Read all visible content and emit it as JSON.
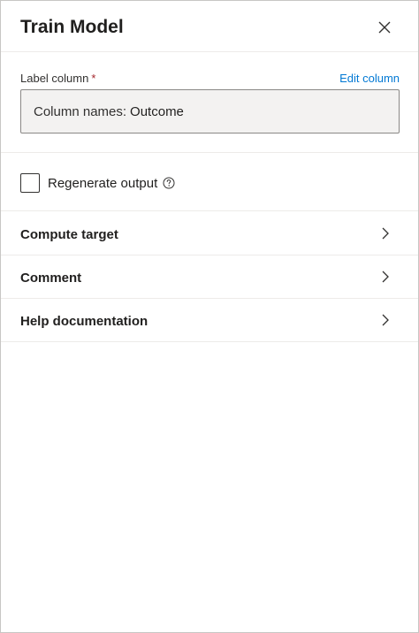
{
  "panel": {
    "title": "Train Model",
    "close_icon": "close-icon"
  },
  "label_column": {
    "label": "Label column",
    "required_marker": "*",
    "edit_link": "Edit column",
    "prefix": "Column names:",
    "value": "Outcome"
  },
  "regenerate": {
    "label": "Regenerate output",
    "checked": false,
    "help_icon": "help-circle-icon"
  },
  "sections": [
    {
      "label": "Compute target",
      "icon": "chevron-right-icon"
    },
    {
      "label": "Comment",
      "icon": "chevron-right-icon"
    },
    {
      "label": "Help documentation",
      "icon": "chevron-right-icon"
    }
  ],
  "colors": {
    "link": "#0078d4",
    "required": "#a4262c",
    "divider": "#edebe9",
    "field_bg": "#f3f2f1"
  }
}
